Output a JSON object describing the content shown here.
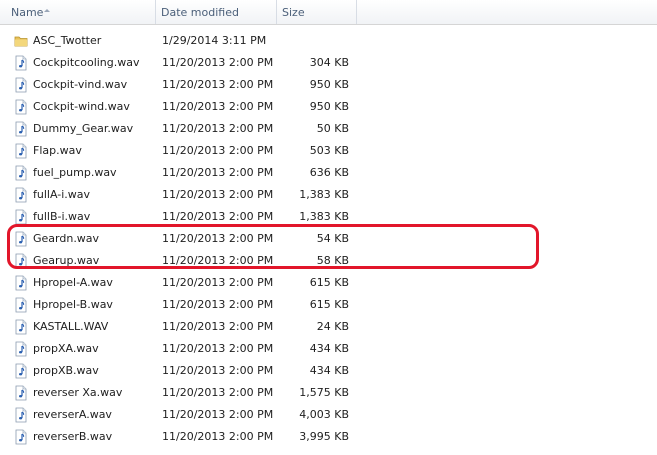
{
  "columns": {
    "name": "Name",
    "date": "Date modified",
    "size": "Size"
  },
  "files": [
    {
      "name": "ASC_Twotter",
      "date": "1/29/2014 3:11 PM",
      "size": "",
      "type": "folder"
    },
    {
      "name": "Cockpitcooling.wav",
      "date": "11/20/2013 2:00 PM",
      "size": "304 KB",
      "type": "audio"
    },
    {
      "name": "Cockpit-vind.wav",
      "date": "11/20/2013 2:00 PM",
      "size": "950 KB",
      "type": "audio"
    },
    {
      "name": "Cockpit-wind.wav",
      "date": "11/20/2013 2:00 PM",
      "size": "950 KB",
      "type": "audio"
    },
    {
      "name": "Dummy_Gear.wav",
      "date": "11/20/2013 2:00 PM",
      "size": "50 KB",
      "type": "audio"
    },
    {
      "name": "Flap.wav",
      "date": "11/20/2013 2:00 PM",
      "size": "503 KB",
      "type": "audio"
    },
    {
      "name": "fuel_pump.wav",
      "date": "11/20/2013 2:00 PM",
      "size": "636 KB",
      "type": "audio"
    },
    {
      "name": "fullA-i.wav",
      "date": "11/20/2013 2:00 PM",
      "size": "1,383 KB",
      "type": "audio"
    },
    {
      "name": "fullB-i.wav",
      "date": "11/20/2013 2:00 PM",
      "size": "1,383 KB",
      "type": "audio"
    },
    {
      "name": "Geardn.wav",
      "date": "11/20/2013 2:00 PM",
      "size": "54 KB",
      "type": "audio"
    },
    {
      "name": "Gearup.wav",
      "date": "11/20/2013 2:00 PM",
      "size": "58 KB",
      "type": "audio"
    },
    {
      "name": "Hpropel-A.wav",
      "date": "11/20/2013 2:00 PM",
      "size": "615 KB",
      "type": "audio"
    },
    {
      "name": "Hpropel-B.wav",
      "date": "11/20/2013 2:00 PM",
      "size": "615 KB",
      "type": "audio"
    },
    {
      "name": "KASTALL.WAV",
      "date": "11/20/2013 2:00 PM",
      "size": "24 KB",
      "type": "audio"
    },
    {
      "name": "propXA.wav",
      "date": "11/20/2013 2:00 PM",
      "size": "434 KB",
      "type": "audio"
    },
    {
      "name": "propXB.wav",
      "date": "11/20/2013 2:00 PM",
      "size": "434 KB",
      "type": "audio"
    },
    {
      "name": "reverser Xa.wav",
      "date": "11/20/2013 2:00 PM",
      "size": "1,575 KB",
      "type": "audio"
    },
    {
      "name": "reverserA.wav",
      "date": "11/20/2013 2:00 PM",
      "size": "4,003 KB",
      "type": "audio"
    },
    {
      "name": "reverserB.wav",
      "date": "11/20/2013 2:00 PM",
      "size": "3,995 KB",
      "type": "audio"
    }
  ],
  "highlight_color": "#e2162a"
}
